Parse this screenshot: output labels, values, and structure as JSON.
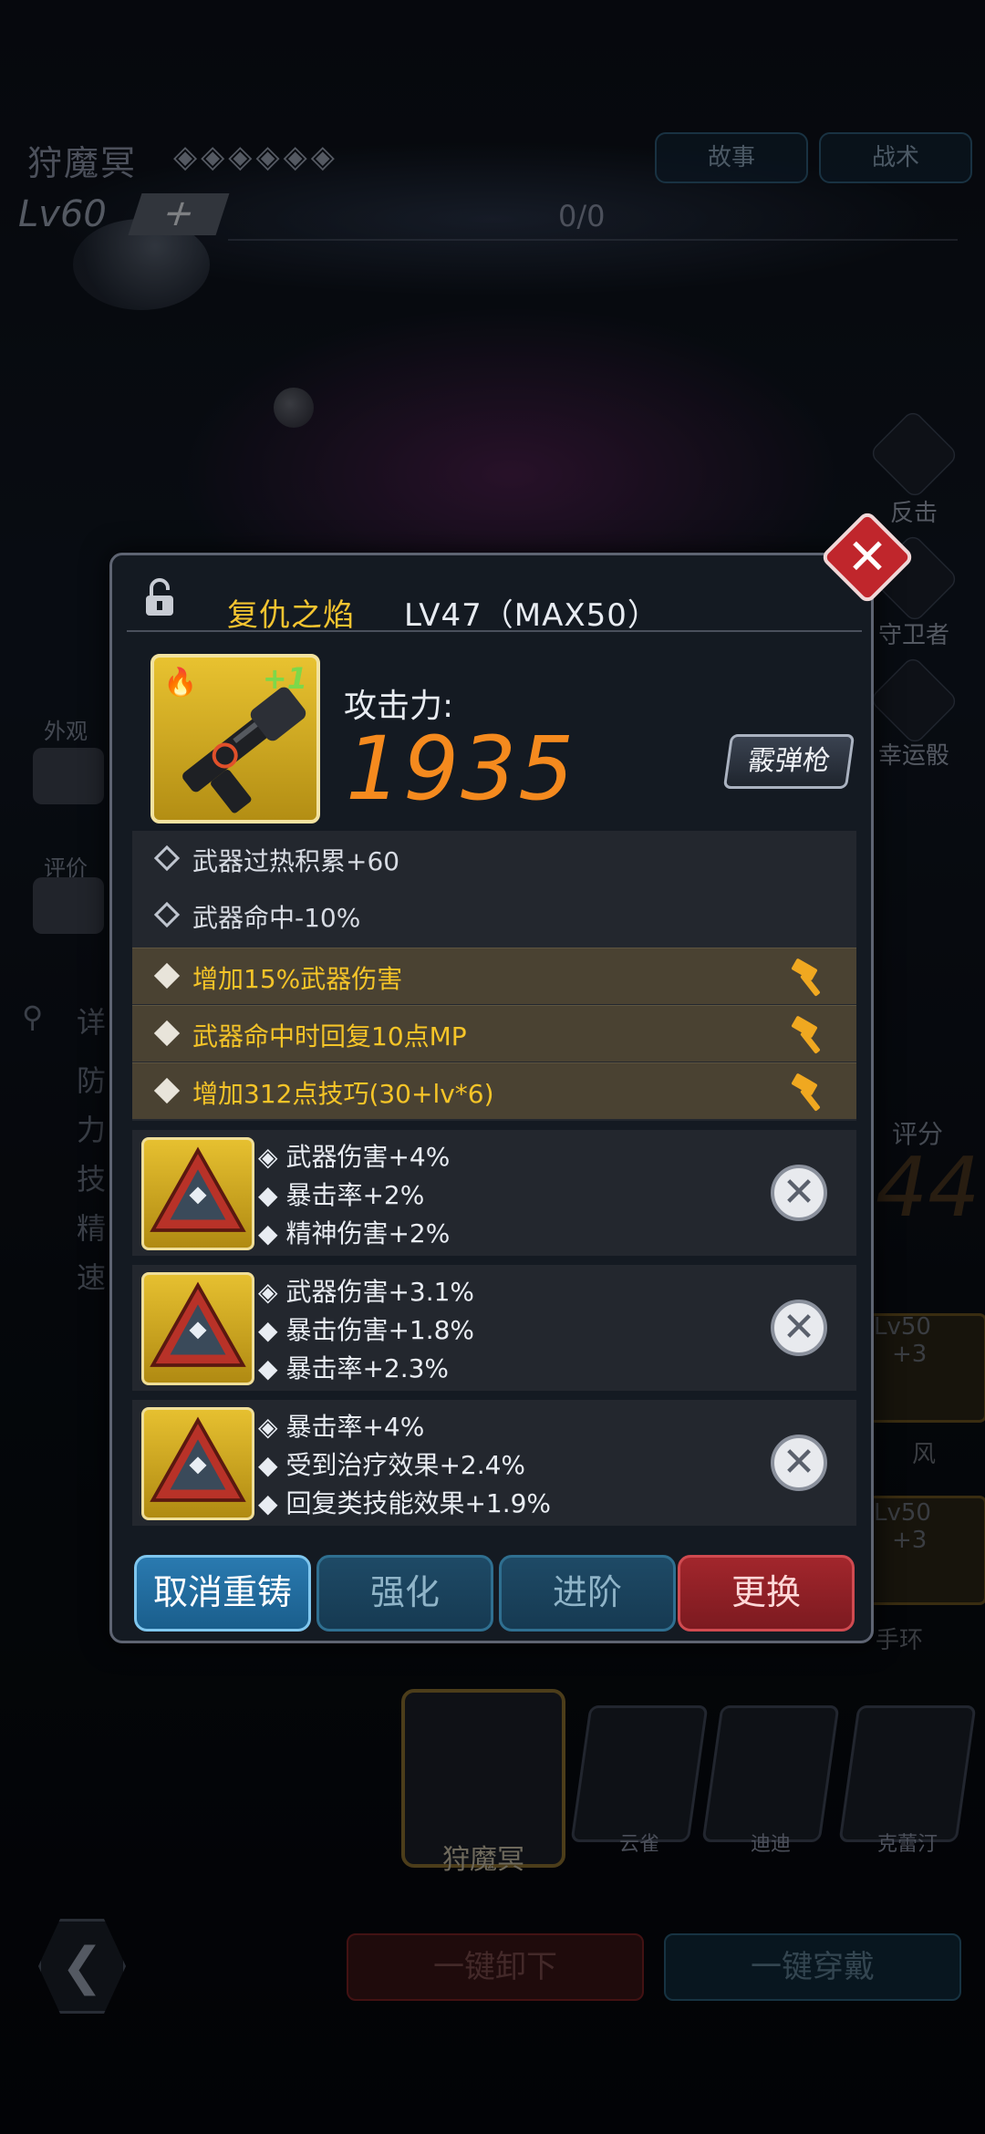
{
  "header": {
    "hero_name": "狩魔冥",
    "stars": "◈◈◈◈◈◈",
    "level": "Lv60",
    "plus": "+",
    "progress": "0/0",
    "story_btn": "故事",
    "tactics_btn": "战术"
  },
  "side": {
    "items": [
      "反击",
      "守卫者",
      "幸运骰"
    ],
    "appearance": "外观",
    "rating": "评价",
    "detail": "详",
    "stats": [
      "防",
      "力",
      "技",
      "精",
      "速"
    ]
  },
  "background": {
    "score_label": "评分",
    "score_value": "44",
    "card1_lv": "Lv50",
    "card1_plus": "+3",
    "card1_name": "风",
    "card2_lv": "Lv50",
    "card2_plus": "+3",
    "card2_name": "手环"
  },
  "heroes": {
    "main": "狩魔冥",
    "list": [
      "云雀",
      "迪迪",
      "克蕾汀"
    ]
  },
  "bottom": {
    "unequip_all": "一键卸下",
    "equip_all": "一键穿戴"
  },
  "dialog": {
    "weapon_name": "复仇之焰",
    "weapon_level": "LV47（MAX50）",
    "plus_level": "+1",
    "attack_label": "攻击力:",
    "attack_value": "1935",
    "weapon_type": "霰弹枪",
    "base_attrs": [
      "武器过热积累+60",
      "武器命中-10%"
    ],
    "extra_attrs": [
      "增加15%武器伤害",
      "武器命中时回复10点MP",
      "增加312点技巧(30+lv*6)"
    ],
    "gems": [
      {
        "lines": [
          "武器伤害+4%",
          "暴击率+2%",
          "精神伤害+2%"
        ]
      },
      {
        "lines": [
          "武器伤害+3.1%",
          "暴击伤害+1.8%",
          "暴击率+2.3%"
        ]
      },
      {
        "lines": [
          "暴击率+4%",
          "受到治疗效果+2.4%",
          "回复类技能效果+1.9%"
        ]
      }
    ],
    "buttons": {
      "cancel_reforge": "取消重铸",
      "enhance": "强化",
      "advance": "进阶",
      "replace": "更换"
    }
  },
  "colors": {
    "gold_text": "#f5c428",
    "attack_orange": "#f58a1e",
    "close_red": "#c0262c"
  }
}
